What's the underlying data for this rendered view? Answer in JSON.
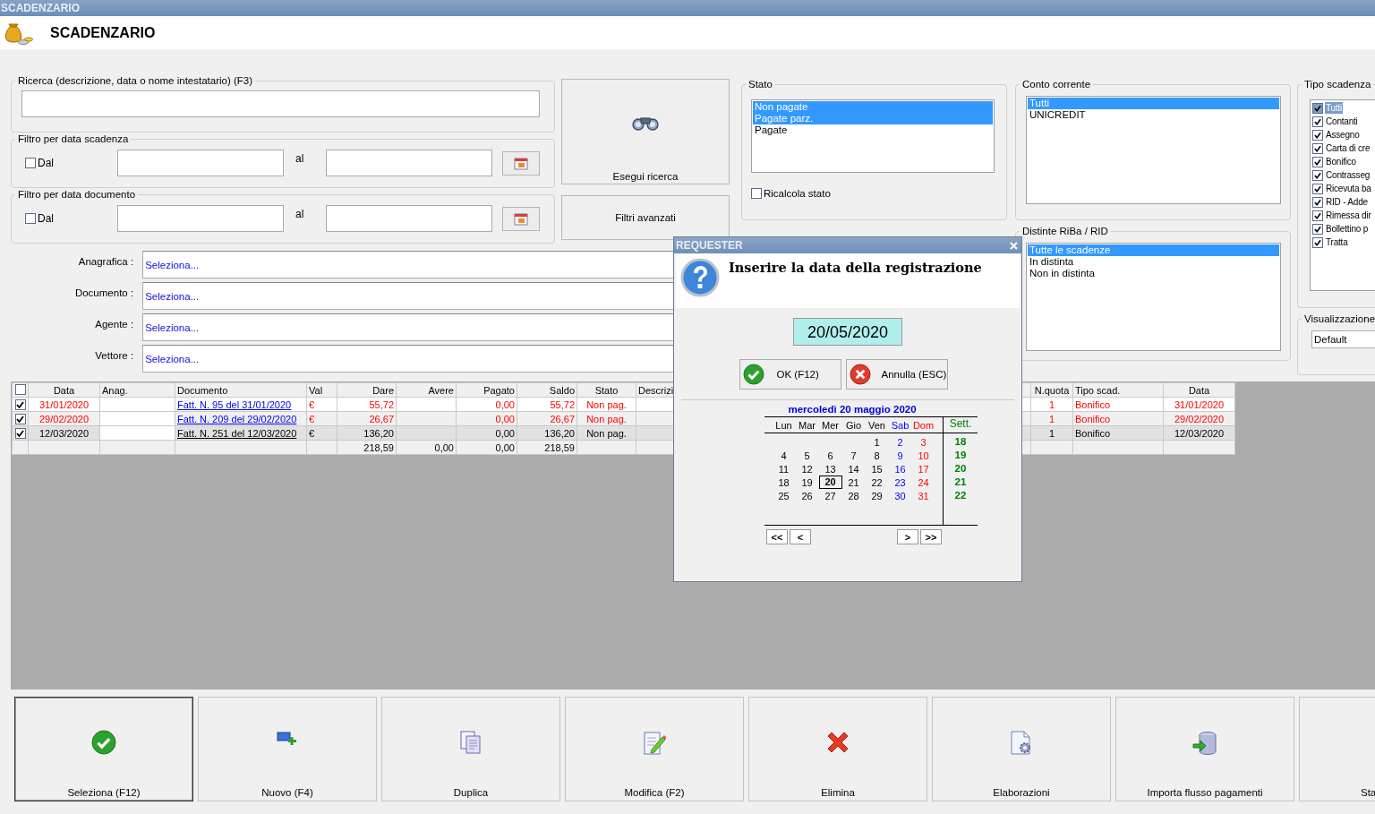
{
  "window": {
    "title": "SCADENZARIO"
  },
  "header": {
    "title": "SCADENZARIO"
  },
  "search": {
    "label": "Ricerca (descrizione, data o nome intestatario) (F3)"
  },
  "date_filters": [
    {
      "label": "Filtro per data scadenza",
      "from_label": "Dal",
      "checked": false,
      "to_label": "al"
    },
    {
      "label": "Filtro per data documento",
      "from_label": "Dal",
      "checked": false,
      "to_label": "al"
    }
  ],
  "search_button": {
    "label": "Esegui ricerca"
  },
  "advanced_button": {
    "label": "Filtri avanzati"
  },
  "lookups": [
    {
      "label": "Anagrafica :",
      "value": "Seleziona..."
    },
    {
      "label": "Documento :",
      "value": "Seleziona..."
    },
    {
      "label": "Agente :",
      "value": "Seleziona..."
    },
    {
      "label": "Vettore :",
      "value": "Seleziona..."
    }
  ],
  "stato": {
    "label": "Stato",
    "items": [
      {
        "label": "Non pagate",
        "selected": true
      },
      {
        "label": "Pagate parz.",
        "selected": true
      },
      {
        "label": "Pagate",
        "selected": false
      }
    ],
    "recalc": {
      "label": "Ricalcola stato",
      "checked": false
    }
  },
  "conto": {
    "label": "Conto corrente",
    "items": [
      {
        "label": "Tutti",
        "selected": true
      },
      {
        "label": "UNICREDIT",
        "selected": false
      }
    ]
  },
  "distinte": {
    "label": "Distinte RiBa / RID",
    "items": [
      {
        "label": "Tutte le scadenze",
        "selected": true
      },
      {
        "label": "In distinta",
        "selected": false
      },
      {
        "label": "Non in distinta",
        "selected": false
      }
    ]
  },
  "tipo": {
    "label": "Tipo scadenza",
    "items": [
      {
        "label": "Tutti",
        "checked": true,
        "selected": true
      },
      {
        "label": "Contanti",
        "checked": true,
        "selected": false
      },
      {
        "label": "Assegno",
        "checked": true,
        "selected": false
      },
      {
        "label": "Carta di cre",
        "checked": true,
        "selected": false
      },
      {
        "label": "Bonifico",
        "checked": true,
        "selected": false
      },
      {
        "label": "Contrasseg",
        "checked": true,
        "selected": false
      },
      {
        "label": "Ricevuta ba",
        "checked": true,
        "selected": false
      },
      {
        "label": "RID - Adde",
        "checked": true,
        "selected": false
      },
      {
        "label": "Rimessa dir",
        "checked": true,
        "selected": false
      },
      {
        "label": "Bollettino p",
        "checked": true,
        "selected": false
      },
      {
        "label": "Tratta",
        "checked": true,
        "selected": false
      }
    ]
  },
  "visualizzazione": {
    "label": "Visualizzazione",
    "value": "Default"
  },
  "table": {
    "header_checked": false,
    "columns": [
      "Data",
      "Anag.",
      "Documento",
      "Val",
      "Dare",
      "Avere",
      "Pagato",
      "Saldo",
      "Stato",
      "Descrizi",
      "N.quota",
      "Tipo scad.",
      "Data"
    ],
    "rows": [
      {
        "checked": true,
        "overdue": true,
        "selected": false,
        "data": "31/01/2020",
        "documento": "Fatt. N. 95 del 31/01/2020",
        "val": "€",
        "dare": "55,72",
        "pagato": "0,00",
        "saldo": "55,72",
        "stato": "Non pag.",
        "n_quota": "1",
        "tipo_scad": "Bonifico",
        "data_2": "31/01/2020"
      },
      {
        "checked": true,
        "overdue": true,
        "selected": false,
        "data": "29/02/2020",
        "documento": "Fatt. N. 209 del 29/02/2020",
        "val": "€",
        "dare": "26,67",
        "pagato": "0,00",
        "saldo": "26,67",
        "stato": "Non pag.",
        "n_quota": "1",
        "tipo_scad": "Bonifico",
        "data_2": "29/02/2020"
      },
      {
        "checked": true,
        "overdue": false,
        "selected": true,
        "data": "12/03/2020",
        "documento": "Fatt. N. 251 del 12/03/2020",
        "val": "€",
        "dare": "136,20",
        "pagato": "0,00",
        "saldo": "136,20",
        "stato": "Non pag.",
        "n_quota": "1",
        "tipo_scad": "Bonifico",
        "data_2": "12/03/2020"
      }
    ],
    "totals": {
      "dare": "218,59",
      "avere": "0,00",
      "pagato": "0,00",
      "saldo": "218,59"
    }
  },
  "dialog": {
    "title": "REQUESTER",
    "message": "Inserire la data della registrazione",
    "date": "20/05/2020",
    "buttons": [
      {
        "label": "OK (F12)",
        "kind": "ok"
      },
      {
        "label": "Annulla (ESC)",
        "kind": "cancel"
      }
    ],
    "calendar": {
      "caption": "mercoledì 20 maggio 2020",
      "weekdays": [
        {
          "label": "Lun",
          "kind": "weekday"
        },
        {
          "label": "Mar",
          "kind": "weekday"
        },
        {
          "label": "Mer",
          "kind": "weekday"
        },
        {
          "label": "Gio",
          "kind": "weekday"
        },
        {
          "label": "Ven",
          "kind": "weekday"
        },
        {
          "label": "Sab",
          "kind": "saturday"
        },
        {
          "label": "Dom",
          "kind": "sunday"
        }
      ],
      "week_label": "Sett.",
      "weeks": [
        {
          "number": "18",
          "days": [
            {
              "label": "1",
              "selected": false
            },
            {
              "label": "2",
              "selected": false
            },
            {
              "label": "3",
              "selected": false
            }
          ]
        },
        {
          "number": "19",
          "days": [
            {
              "label": "4",
              "selected": false
            },
            {
              "label": "5",
              "selected": false
            },
            {
              "label": "6",
              "selected": false
            },
            {
              "label": "7",
              "selected": false
            },
            {
              "label": "8",
              "selected": false
            },
            {
              "label": "9",
              "selected": false
            },
            {
              "label": "10",
              "selected": false
            }
          ]
        },
        {
          "number": "20",
          "days": [
            {
              "label": "11",
              "selected": false
            },
            {
              "label": "12",
              "selected": false
            },
            {
              "label": "13",
              "selected": false
            },
            {
              "label": "14",
              "selected": false
            },
            {
              "label": "15",
              "selected": false
            },
            {
              "label": "16",
              "selected": false
            },
            {
              "label": "17",
              "selected": false
            }
          ]
        },
        {
          "number": "21",
          "days": [
            {
              "label": "18",
              "selected": false
            },
            {
              "label": "19",
              "selected": false
            },
            {
              "label": "20",
              "selected": true
            },
            {
              "label": "21",
              "selected": false
            },
            {
              "label": "22",
              "selected": false
            },
            {
              "label": "23",
              "selected": false
            },
            {
              "label": "24",
              "selected": false
            }
          ]
        },
        {
          "number": "22",
          "days": [
            {
              "label": "25",
              "selected": false
            },
            {
              "label": "26",
              "selected": false
            },
            {
              "label": "27",
              "selected": false
            },
            {
              "label": "28",
              "selected": false
            },
            {
              "label": "29",
              "selected": false
            },
            {
              "label": "30",
              "selected": false
            },
            {
              "label": "31",
              "selected": false
            }
          ]
        }
      ],
      "nav_back": [
        "<<",
        "<"
      ],
      "nav_forward": [
        ">",
        ">>"
      ]
    }
  },
  "toolbar": [
    {
      "label": "Seleziona (F12)",
      "default": true
    },
    {
      "label": "Nuovo (F4)",
      "default": false
    },
    {
      "label": "Duplica",
      "default": false
    },
    {
      "label": "Modifica (F2)",
      "default": false
    },
    {
      "label": "Elimina",
      "default": false
    },
    {
      "label": "Elaborazioni",
      "default": false
    },
    {
      "label": "Importa flusso pagamenti",
      "default": false
    },
    {
      "label": "Sta",
      "default": false
    }
  ]
}
